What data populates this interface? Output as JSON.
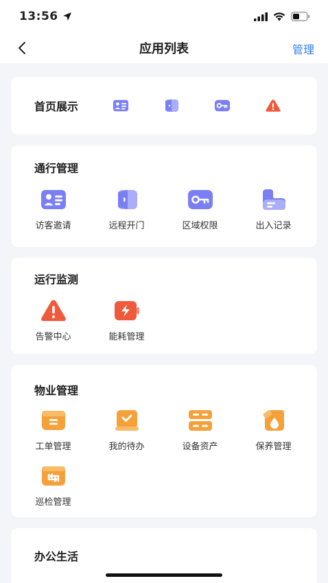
{
  "status_bar": {
    "time": "13:56"
  },
  "nav": {
    "title": "应用列表",
    "manage_label": "管理"
  },
  "home_display": {
    "title": "首页展示",
    "icons": [
      "visitor-card-icon",
      "door-icon",
      "key-icon",
      "alert-icon"
    ]
  },
  "pass_management": {
    "title": "通行管理",
    "items": [
      {
        "label": "访客邀请",
        "icon": "visitor-card-icon"
      },
      {
        "label": "远程开门",
        "icon": "door-icon"
      },
      {
        "label": "区域权限",
        "icon": "key-icon"
      },
      {
        "label": "出入记录",
        "icon": "record-icon"
      }
    ]
  },
  "operation_monitoring": {
    "title": "运行监测",
    "items": [
      {
        "label": "告警中心",
        "icon": "alert-icon"
      },
      {
        "label": "能耗管理",
        "icon": "battery-icon"
      }
    ]
  },
  "property_management": {
    "title": "物业管理",
    "items": [
      {
        "label": "工单管理",
        "icon": "work-order-icon"
      },
      {
        "label": "我的待办",
        "icon": "todo-icon"
      },
      {
        "label": "设备资产",
        "icon": "device-asset-icon"
      },
      {
        "label": "保养管理",
        "icon": "maintenance-icon"
      },
      {
        "label": "巡检管理",
        "icon": "inspection-icon"
      }
    ]
  },
  "office_life": {
    "title": "办公生活"
  },
  "colors": {
    "purple": "#7b7ff4",
    "purple_light": "#a9adfa",
    "red": "#ef5a3c",
    "orange": "#f5a13a",
    "blue_link": "#2f7df6"
  }
}
